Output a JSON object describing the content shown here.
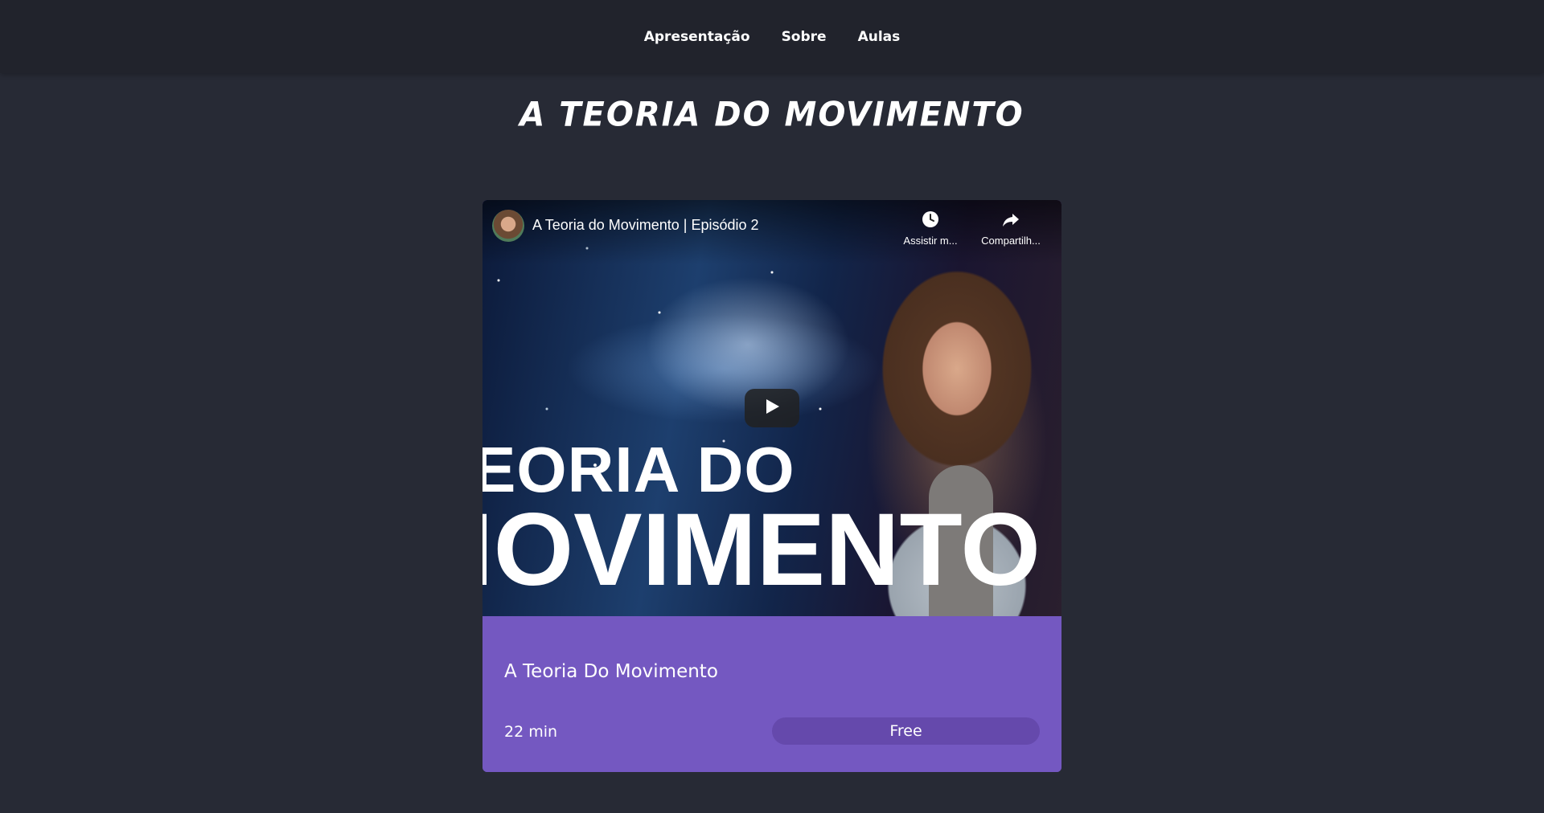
{
  "nav": {
    "items": [
      {
        "label": "Apresentação"
      },
      {
        "label": "Sobre"
      },
      {
        "label": "Aulas"
      }
    ]
  },
  "page": {
    "title": "A TEORIA DO MOVIMENTO"
  },
  "video": {
    "title": "A Teoria do Movimento | Episódio 2",
    "watch_later_label": "Assistir m...",
    "share_label": "Compartilh...",
    "thumbnail_text_line1": "EORIA DO",
    "thumbnail_text_line2": "IOVIMENTO",
    "icons": {
      "watch_later": "clock-icon",
      "share": "share-icon",
      "play": "play-icon"
    }
  },
  "course": {
    "title": "A Teoria Do Movimento",
    "duration": "22 min",
    "price": "Free"
  },
  "colors": {
    "background": "#272a35",
    "topbar": "#21232c",
    "card": "#7458c1",
    "badge": "#6549ac"
  }
}
